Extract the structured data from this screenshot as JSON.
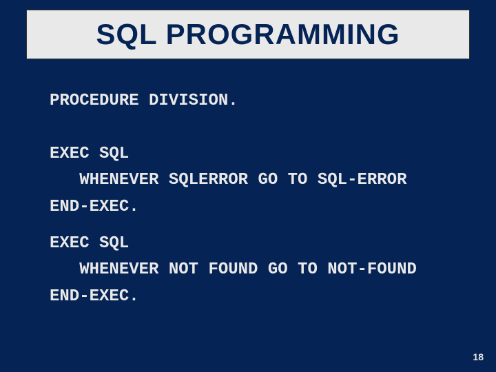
{
  "title": "SQL PROGRAMMING",
  "code1": "PROCEDURE DIVISION.",
  "code2": "EXEC SQL\n   WHENEVER SQLERROR GO TO SQL-ERROR\nEND-EXEC.",
  "code3": "EXEC SQL\n   WHENEVER NOT FOUND GO TO NOT-FOUND\nEND-EXEC.",
  "pageNumber": "18"
}
